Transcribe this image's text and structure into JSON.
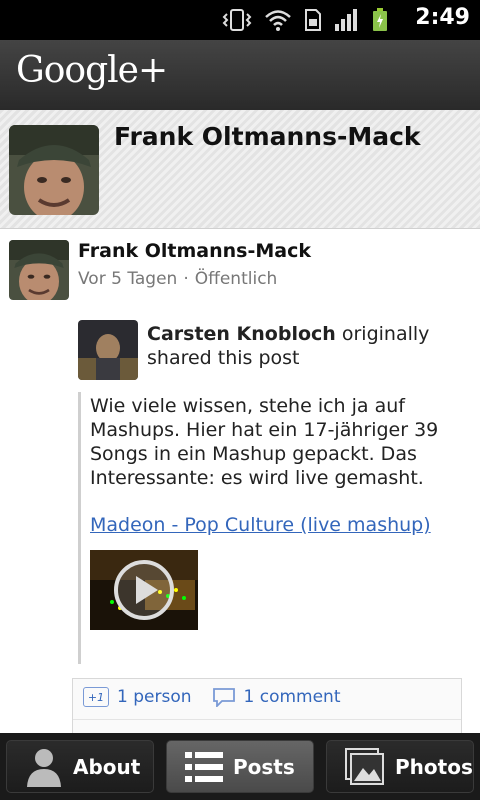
{
  "status_bar": {
    "time": "2:49"
  },
  "app_bar": {
    "logo": "Google+"
  },
  "profile": {
    "name": "Frank Oltmanns-Mack"
  },
  "post": {
    "author": "Frank Oltmanns-Mack",
    "time": "Vor 5 Tagen",
    "separator": "·",
    "visibility": "Öffentlich",
    "original_author": "Carsten Knobloch",
    "shared_text": "originally shared this post",
    "text": "Wie viele wissen, stehe ich ja auf Mashups. Hier hat ein 17-jähriger 39 Songs in ein Mashup gepackt. Das Interessante: es wird live gemasht.",
    "link_text": "Madeon - Pop Culture (live mashup)"
  },
  "stats": {
    "plus_badge": "+1",
    "plus_count": "1 person",
    "comment_count": "1 comment"
  },
  "tabs": [
    {
      "label": "About",
      "icon": "person-icon"
    },
    {
      "label": "Posts",
      "icon": "list-icon"
    },
    {
      "label": "Photos",
      "icon": "photos-icon"
    }
  ],
  "colors": {
    "link": "#3366bb",
    "appbar": "#333333",
    "statusbar": "#000000"
  }
}
